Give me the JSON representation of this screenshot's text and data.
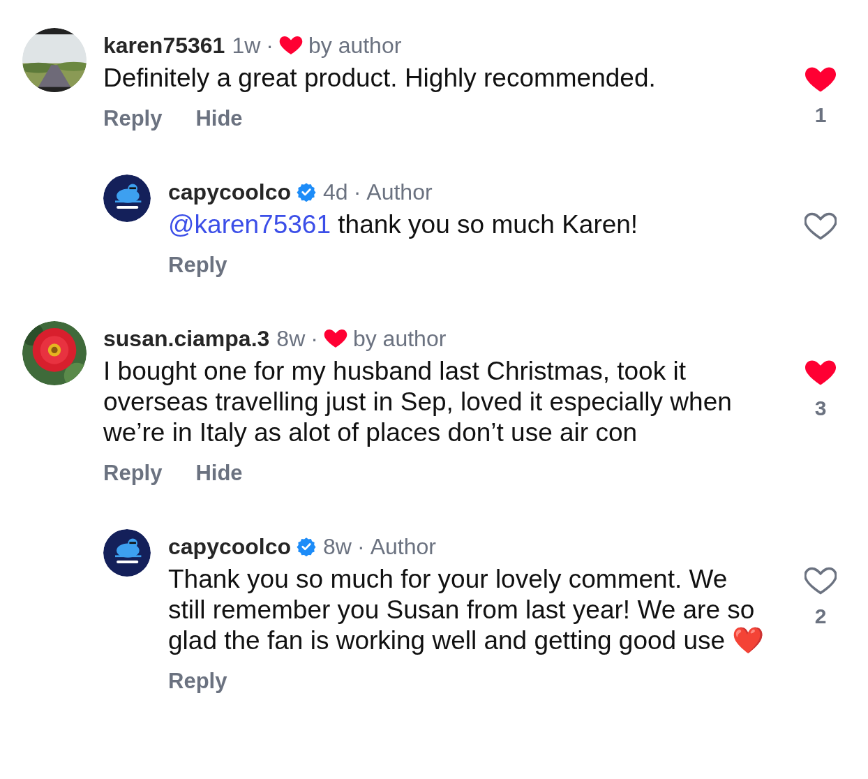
{
  "comments": [
    {
      "kind": "comment",
      "avatar": {
        "kind": "picture"
      },
      "username": "karen75361",
      "time": "1w",
      "separator": "·",
      "liked_by_author": true,
      "liked_by_label": "by author",
      "text": "Definitely a great product. Highly recommended.",
      "actions": [
        "Reply",
        "Hide"
      ],
      "liked": true,
      "like_count": "1"
    },
    {
      "kind": "reply",
      "avatar": {
        "kind": "picture"
      },
      "username": "capycoolco",
      "verified": true,
      "time": "4d",
      "separator": "·",
      "author_label": "Author",
      "mention": "@karen75361",
      "text": "thank you so much Karen!",
      "actions": [
        "Reply"
      ],
      "liked": false
    },
    {
      "kind": "comment",
      "avatar": {
        "kind": "picture"
      },
      "username": "susan.ciampa.3",
      "time": "8w",
      "separator": "·",
      "liked_by_author": true,
      "liked_by_label": "by author",
      "text": "I bought one for my husband last Christmas, took it overseas travelling just in Sep, loved it especially when we’re in Italy as alot of places don’t use air con",
      "actions": [
        "Reply",
        "Hide"
      ],
      "liked": true,
      "like_count": "3"
    },
    {
      "kind": "reply",
      "avatar": {
        "kind": "picture"
      },
      "username": "capycoolco",
      "verified": true,
      "time": "8w",
      "separator": "·",
      "author_label": "Author",
      "text": "Thank you so much for your lovely comment. We still remember you Susan from last year! We are so glad the fan is working well and getting good use",
      "emoji": "❤️",
      "actions": [
        "Reply"
      ],
      "liked": false,
      "like_count": "2"
    }
  ]
}
